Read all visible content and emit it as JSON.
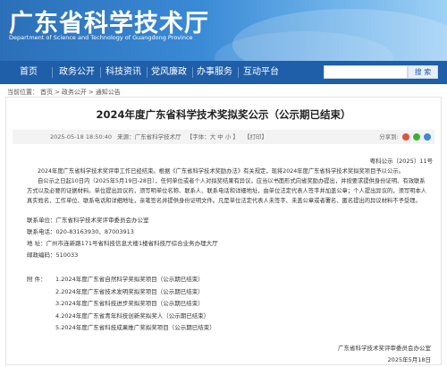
{
  "header": {
    "title": "广东省科学技术厅",
    "subtitle": "Department of Science and Technology of Guangdong Province"
  },
  "nav": {
    "items": [
      "首页",
      "政务公开",
      "科技资讯",
      "党风廉政",
      "办事服务",
      "互动平台"
    ],
    "search_button": "搜 索"
  },
  "breadcrumb": {
    "label": "当前位置：",
    "items": [
      "首页",
      "政务公开",
      "通知公告"
    ],
    "sep": ">"
  },
  "article": {
    "title": "2024年度广东省科学技术奖拟奖公示（公示期已结束）",
    "meta": {
      "date": "2025-05-18 18:50:40",
      "source": "来源：广东省科学技术厅",
      "font_size": "【字体：大  中  小 】",
      "print": "【打印】",
      "share": "分享到:"
    },
    "doc_no": "粤科公示〔2025〕11号",
    "paragraphs": [
      "2024年度广东省科学技术奖评审工作已经结束。根据《广东省科学技术奖励办法》有关规定，现将2024年度广东省科学技术奖拟奖项目予以公示。",
      "自公示之日起10日内（2025年5月19日-28日），任何单位或者个人对拟奖结果有异议，应当以书面形式向省奖励办提出，并按要求提供身份证明、有效联系方式以及必要的证据材料。单位提出异议的，须写明单位名称、联系人、联系电话和详细地址，由单位法定代表人签字并加盖公章；个人提出异议的，须写明本人真实姓名、工作单位、联系电话和详细地址，亲笔签名并提供身份证明文件。凡是单位法定代表人未签字、未盖公章或者署名、匿名提出的异议材料不予受理。"
    ],
    "contact": [
      {
        "label": "联系单位：",
        "value": "广东省科学技术奖评审委员会办公室"
      },
      {
        "label": "联系电话：",
        "value": "020-83163930、87003913"
      },
      {
        "label": "地    址：",
        "value": "广州市连新路171号省科技信息大楼1楼省科技厅综合业务办理大厅"
      },
      {
        "label": "邮政编码：",
        "value": "510033"
      }
    ],
    "attachments_label": "附    件：",
    "attachments": [
      "1.2024年度广东省自然科学奖拟奖项目（公示期已结束）",
      "2.2024年度广东省技术发明奖拟奖项目（公示期已结束）",
      "3.2024年度广东省科技进步奖拟奖项目（公示期已结束）",
      "4.2024年度广东省青年科技创新奖拟奖人（公示期已结束）",
      "5.2024年度广东省科技成果推广奖拟奖项目（公示期已结束）"
    ],
    "sign": {
      "org": "广东省科学技术奖评审委员会办公室",
      "date": "2025年5月18日"
    }
  },
  "colors": {
    "nav_bg": "#1f5ea8",
    "banner_start": "#2b6fb8",
    "banner_end": "#9fd0f5"
  }
}
